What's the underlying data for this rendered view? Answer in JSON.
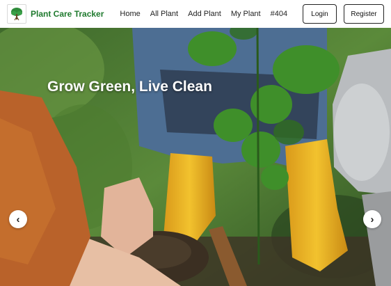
{
  "navbar": {
    "brand": "Plant Care Tracker",
    "logo_icon": "tree-icon",
    "links": [
      "Home",
      "All Plant",
      "Add Plant",
      "My Plant",
      "#404"
    ],
    "login_label": "Login",
    "register_label": "Register"
  },
  "hero": {
    "title": "Grow Green, Live Clean",
    "prev_glyph": "‹",
    "next_glyph": "›",
    "prev_icon": "chevron-left-icon",
    "next_icon": "chevron-right-icon"
  },
  "colors": {
    "brand_green": "#1f7a2e",
    "boot_yellow": "#e8b020",
    "jeans_blue": "#4d6e93",
    "foliage": "#3d7a2a"
  }
}
